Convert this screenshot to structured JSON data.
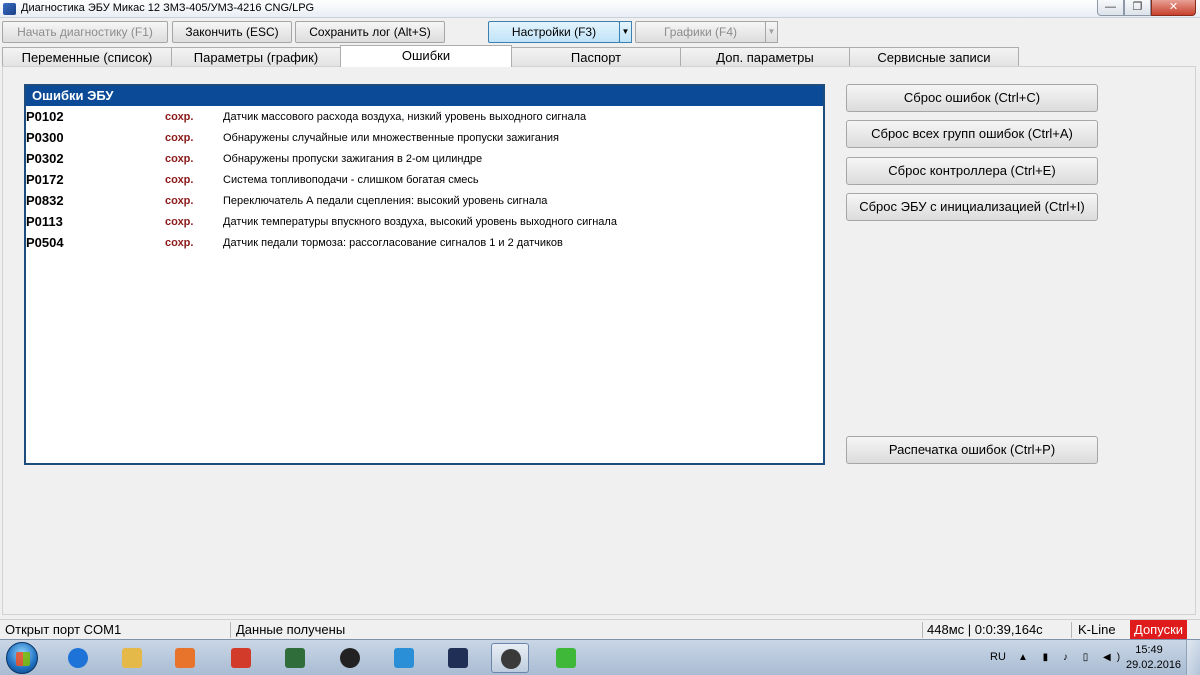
{
  "window": {
    "title": "Диагностика ЭБУ Микас 12 ЗМЗ-405/УМЗ-4216 CNG/LPG",
    "minimize": "—",
    "maximize": "❐",
    "close": "✕"
  },
  "toolbar": {
    "start_diag": "Начать диагностику (F1)",
    "finish": "Закончить (ESC)",
    "save_log": "Сохранить лог (Alt+S)",
    "settings": "Настройки (F3)",
    "graphs": "Графики (F4)",
    "dropdown_arrow": "▼"
  },
  "tabs": [
    {
      "label": "Переменные (список)"
    },
    {
      "label": "Параметры (график)"
    },
    {
      "label": "Ошибки"
    },
    {
      "label": "Паспорт"
    },
    {
      "label": "Доп. параметры"
    },
    {
      "label": "Сервисные записи"
    }
  ],
  "errors": {
    "header": "Ошибки ЭБУ",
    "rows": [
      {
        "code": "P0102",
        "status": "сохр.",
        "desc": "Датчик массового расхода воздуха, низкий уровень выходного сигнала"
      },
      {
        "code": "P0300",
        "status": "сохр.",
        "desc": "Обнаружены случайные или множественные пропуски зажигания"
      },
      {
        "code": "P0302",
        "status": "сохр.",
        "desc": "Обнаружены пропуски зажигания в 2-ом цилиндре"
      },
      {
        "code": "P0172",
        "status": "сохр.",
        "desc": "Система топливоподачи - слишком богатая  смесь"
      },
      {
        "code": "P0832",
        "status": "сохр.",
        "desc": "Переключатель А педали сцепления: высокий уровень сигнала"
      },
      {
        "code": "P0113",
        "status": "сохр.",
        "desc": "Датчик температуры впускного воздуха, высокий уровень выходного сигнала"
      },
      {
        "code": "P0504",
        "status": "сохр.",
        "desc": "Датчик педали тормоза: рассогласование сигналов 1 и 2 датчиков"
      }
    ]
  },
  "actions": {
    "reset_errors": "Сброс ошибок (Ctrl+C)",
    "reset_all_groups": "Сброс всех групп ошибок (Ctrl+A)",
    "reset_controller": "Сброс контроллера (Ctrl+E)",
    "reset_ecu_init": "Сброс ЭБУ с инициализацией (Ctrl+I)",
    "print_errors": "Распечатка ошибок (Ctrl+P)"
  },
  "statusbar": {
    "port": "Открыт порт COM1",
    "data": "Данные получены",
    "timing": "448мс | 0:0:39,164с",
    "protocol": "K-Line",
    "alert": "Допуски"
  },
  "taskbar": {
    "lang": "RU",
    "tray_icons": "▲ ▮ ♪ ▯ ◀)",
    "time": "15:49",
    "date": "29.02.2016",
    "colors": {
      "ie": "#1e73d8",
      "explorer": "#e5b84a",
      "media": "#e8742c",
      "app_red": "#d23a2a",
      "monitor": "#2f6e3a",
      "triangle": "#222222",
      "camera": "#2a8fd6",
      "pulse": "#1f2f55",
      "diag": "#3a3a3a",
      "green_a": "#3fb83a"
    }
  }
}
